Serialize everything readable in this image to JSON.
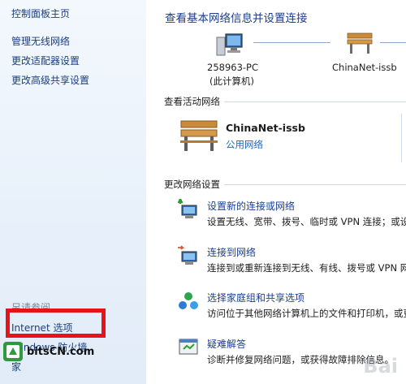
{
  "sidebar": {
    "home": "控制面板主页",
    "links": [
      "管理无线网络",
      "更改适配器设置",
      "更改高级共享设置"
    ],
    "see_also": "另请参阅",
    "see_also_links": [
      "Internet 选项",
      "Windows 防火墙"
    ],
    "partial_item": "家"
  },
  "main": {
    "title": "查看基本网络信息并设置连接",
    "computer_name": "258963-PC",
    "computer_sub": "(此计算机)",
    "network_name": "ChinaNet-issb",
    "active_section": "查看活动网络",
    "active_network": {
      "name": "ChinaNet-issb",
      "type": "公用网络"
    },
    "change_section": "更改网络设置",
    "tasks": [
      {
        "link": "设置新的连接或网络",
        "desc": "设置无线、宽带、拨号、临时或 VPN 连接；或设"
      },
      {
        "link": "连接到网络",
        "desc": "连接到或重新连接到无线、有线、拨号或 VPN 网络"
      },
      {
        "link": "选择家庭组和共享选项",
        "desc": "访问位于其他网络计算机上的文件和打印机，或更"
      },
      {
        "link": "疑难解答",
        "desc": "诊断并修复网络问题，或获得故障排除信息。"
      }
    ]
  },
  "overlay": {
    "logo_text": "bitsCN.com",
    "watermark_text": "Bai"
  },
  "colors": {
    "link": "#1a3e82",
    "highlight": "#e8131a",
    "sidebar_bg": "#e7f0fa"
  }
}
